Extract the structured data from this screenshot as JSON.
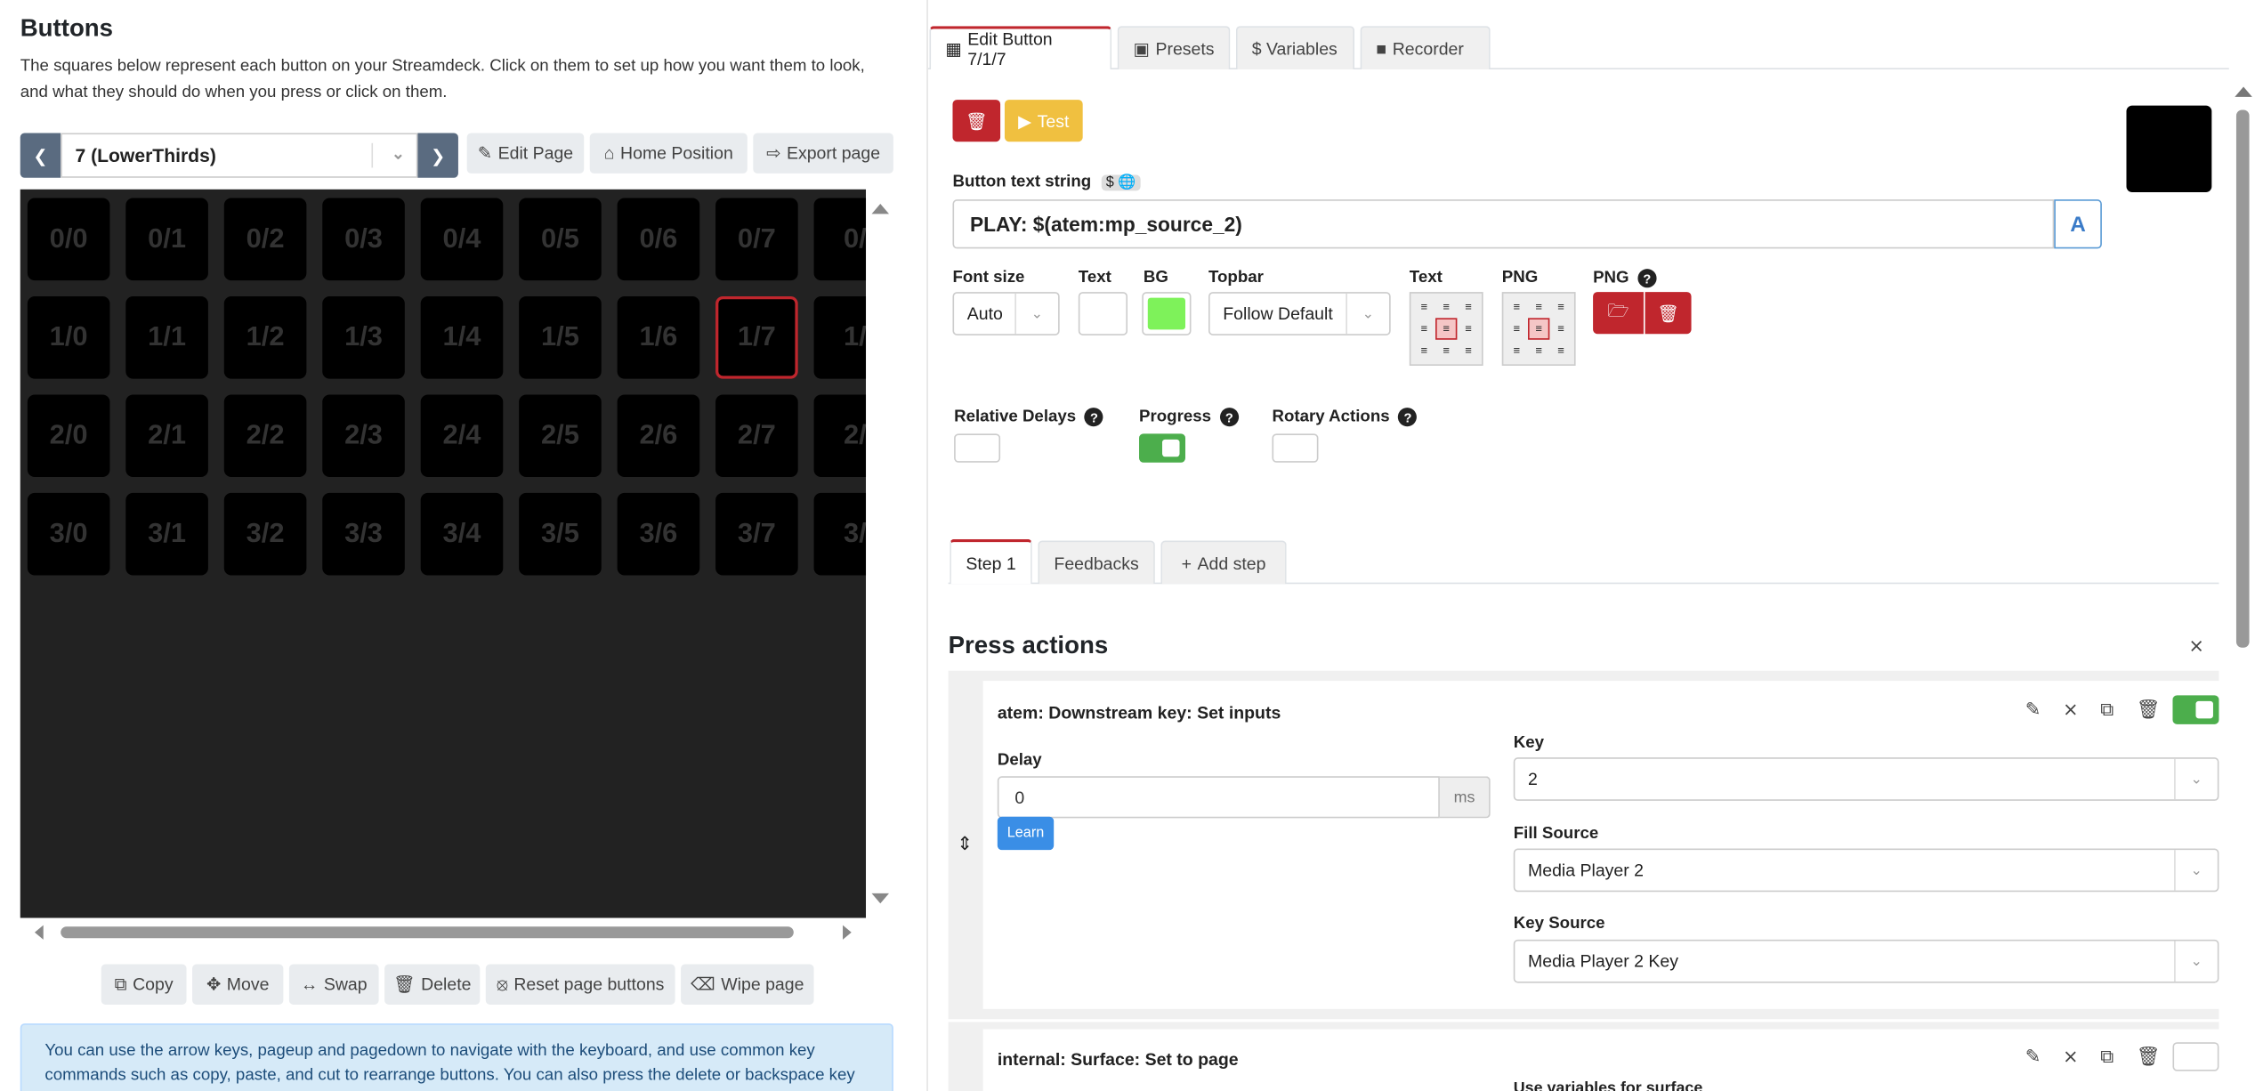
{
  "left": {
    "title": "Buttons",
    "lead": "The squares below represent each button on your Streamdeck. Click on them to set up how you want them to look, and what they should do when you press or click on them.",
    "page_select": "7 (LowerThirds)",
    "edit_page": "Edit Page",
    "home_position": "Home Position",
    "export_page": "Export page",
    "grid": [
      [
        "0/0",
        "0/1",
        "0/2",
        "0/3",
        "0/4",
        "0/5",
        "0/6",
        "0/7",
        "0/"
      ],
      [
        "1/0",
        "1/1",
        "1/2",
        "1/3",
        "1/4",
        "1/5",
        "1/6",
        "1/7",
        "1/"
      ],
      [
        "2/0",
        "2/1",
        "2/2",
        "2/3",
        "2/4",
        "2/5",
        "2/6",
        "2/7",
        "2/"
      ],
      [
        "3/0",
        "3/1",
        "3/2",
        "3/3",
        "3/4",
        "3/5",
        "3/6",
        "3/7",
        "3/"
      ]
    ],
    "selected": "1/7",
    "actions": {
      "copy": "Copy",
      "move": "Move",
      "swap": "Swap",
      "delete": "Delete",
      "reset": "Reset page buttons",
      "wipe": "Wipe page"
    },
    "info": "You can use the arrow keys, pageup and pagedown to navigate with the keyboard, and use common key commands such as copy, paste, and cut to rearrange buttons. You can also press the delete or backspace key with any button highlighted to delete it."
  },
  "right": {
    "tabs": [
      "Edit Button 7/1/7",
      "Presets",
      "$ Variables",
      "Recorder"
    ],
    "test_label": "Test",
    "text_string_label": "Button text string",
    "text_string_value": "PLAY: $(atem:mp_source_2)",
    "font_size_label": "Font size",
    "font_size_value": "Auto",
    "text_label": "Text",
    "bg_label": "BG",
    "bg_color": "#7ef25a",
    "topbar_label": "Topbar",
    "topbar_value": "Follow Default",
    "text_align_label": "Text",
    "png_align_label": "PNG",
    "png_label": "PNG",
    "relative_delays_label": "Relative Delays",
    "progress_label": "Progress",
    "rotary_actions_label": "Rotary Actions",
    "step_tabs": [
      "Step 1",
      "Feedbacks",
      "Add step"
    ],
    "press_actions_title": "Press actions",
    "action1": {
      "title": "atem: Downstream key: Set inputs",
      "delay_label": "Delay",
      "delay_value": "0",
      "delay_unit": "ms",
      "learn": "Learn",
      "key_label": "Key",
      "key_value": "2",
      "fill_source_label": "Fill Source",
      "fill_source_value": "Media Player 2",
      "key_source_label": "Key Source",
      "key_source_value": "Media Player 2 Key"
    },
    "action2": {
      "title": "internal: Surface: Set to page",
      "use_variables_label": "Use variables for surface"
    }
  }
}
